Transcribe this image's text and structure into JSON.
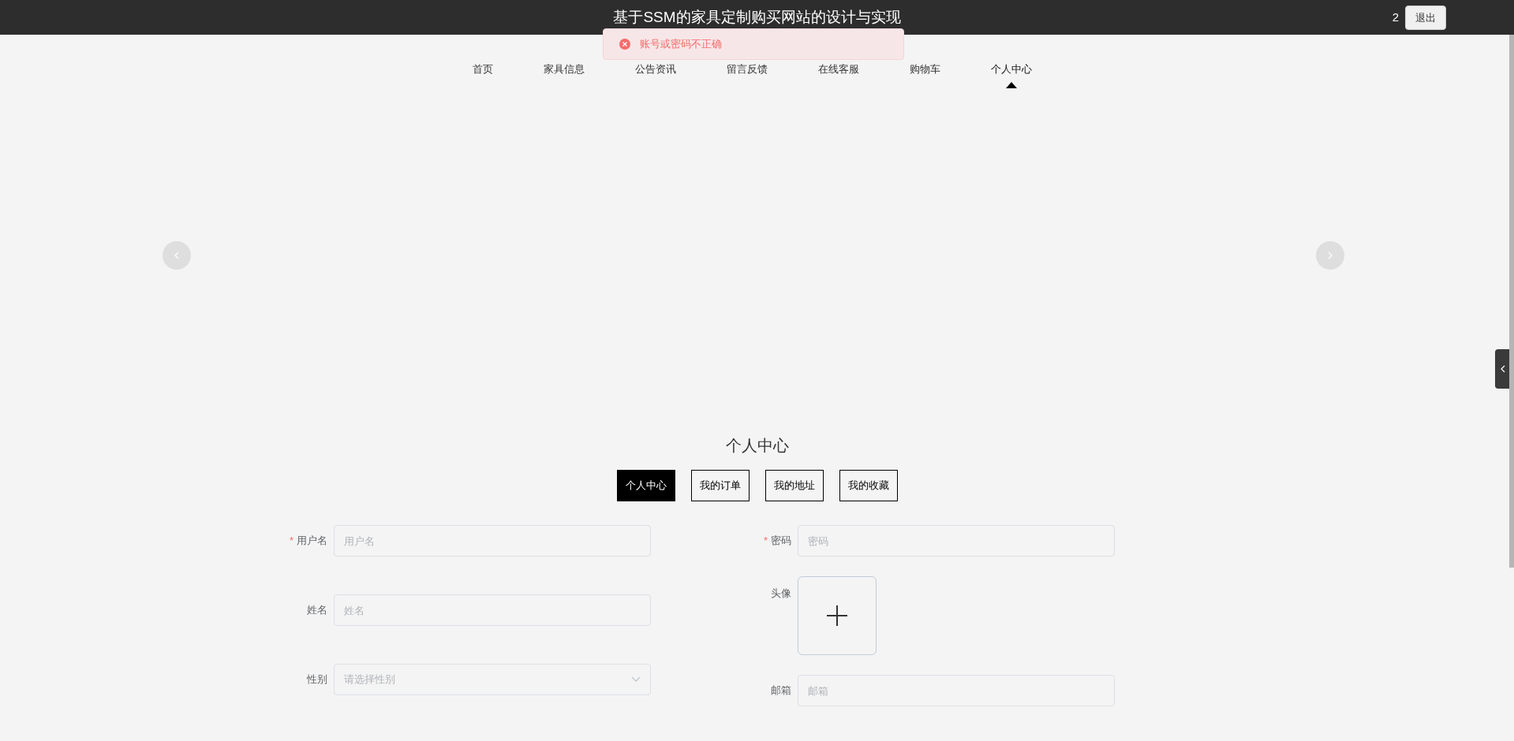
{
  "header": {
    "title": "基于SSM的家具定制购买网站的设计与实现",
    "user": "2",
    "logout": "退出"
  },
  "toast": {
    "message": "账号或密码不正确"
  },
  "nav": [
    {
      "label": "首页",
      "selected": false
    },
    {
      "label": "家具信息",
      "selected": false
    },
    {
      "label": "公告资讯",
      "selected": false
    },
    {
      "label": "留言反馈",
      "selected": false
    },
    {
      "label": "在线客服",
      "selected": false
    },
    {
      "label": "购物车",
      "selected": false
    },
    {
      "label": "个人中心",
      "selected": true
    }
  ],
  "section_title": "个人中心",
  "tabs": [
    {
      "label": "个人中心",
      "selected": true
    },
    {
      "label": "我的订单",
      "selected": false
    },
    {
      "label": "我的地址",
      "selected": false
    },
    {
      "label": "我的收藏",
      "selected": false
    }
  ],
  "form_left": [
    {
      "kind": "text",
      "label": "用户名",
      "required_mark": "*",
      "placeholder": "用户名"
    },
    {
      "kind": "text",
      "label": "姓名",
      "placeholder": "姓名"
    },
    {
      "kind": "select",
      "label": "性别",
      "placeholder": "请选择性别"
    }
  ],
  "form_right": [
    {
      "kind": "text",
      "label": "密码",
      "required_mark": "*",
      "placeholder": "密码"
    },
    {
      "kind": "upload",
      "label": "头像"
    },
    {
      "kind": "text",
      "label": "邮箱",
      "placeholder": "邮箱"
    }
  ]
}
